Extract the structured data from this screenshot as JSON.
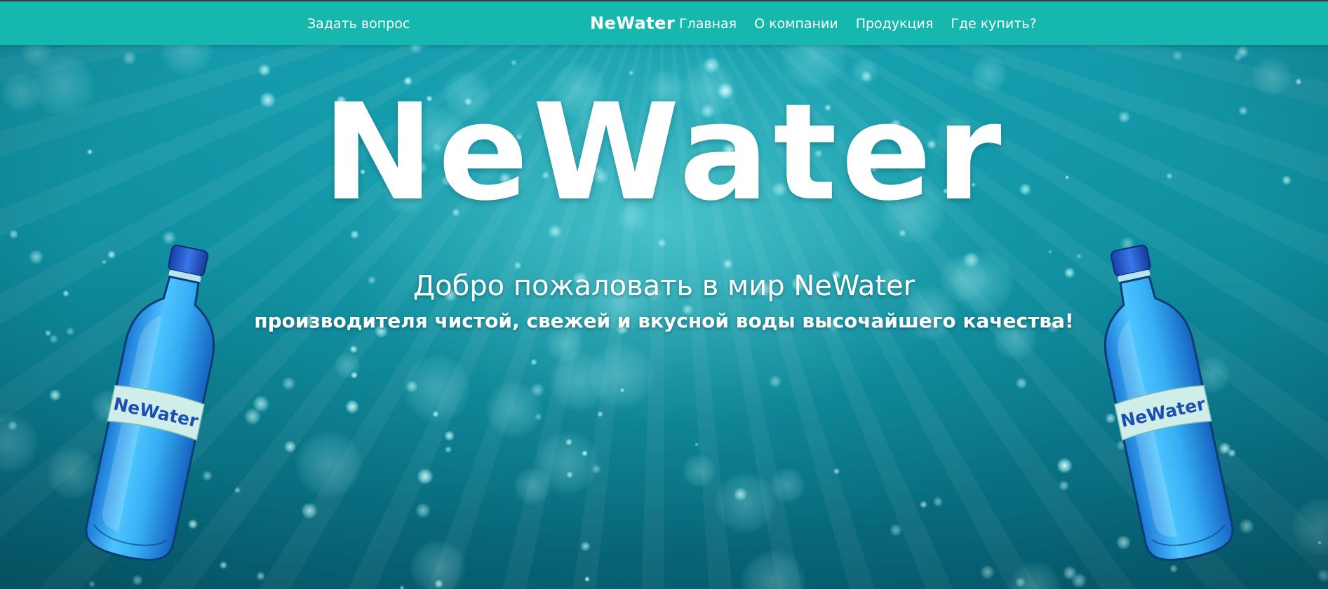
{
  "navbar": {
    "ask_question": "Задать вопрос",
    "brand": "NeWater",
    "links": [
      {
        "label": "Главная"
      },
      {
        "label": "О компании"
      },
      {
        "label": "Продукция"
      },
      {
        "label": "Где купить?"
      }
    ]
  },
  "hero": {
    "logo": "NeWater",
    "title": "Добро пожаловать в мир NeWater",
    "subtitle": "производителя чистой, свежей и вкусной воды высочайшего качества!"
  },
  "bottles": {
    "label": "NeWater"
  },
  "colors": {
    "navbar": "#16b7ad",
    "background": "#0f8fa0",
    "text": "#ffffff",
    "bottle": "#2ea8f0",
    "bottle_cap": "#1f53c8",
    "bottle_label_text": "#1d4fb0"
  }
}
